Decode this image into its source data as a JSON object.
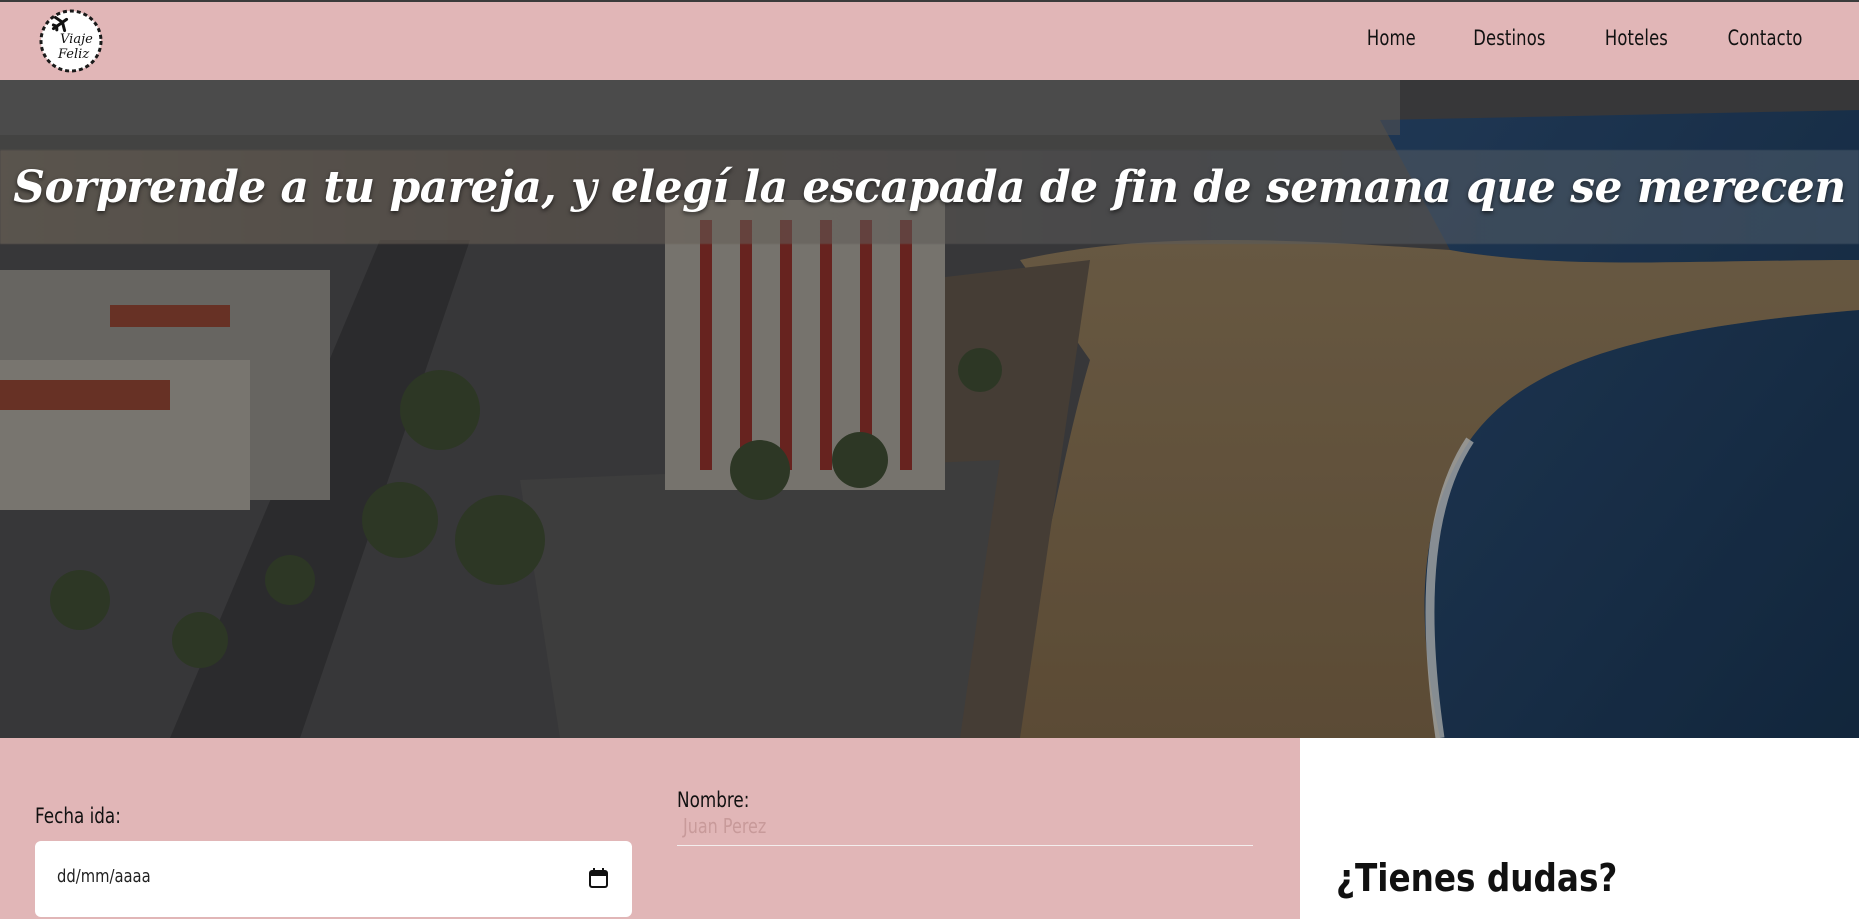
{
  "brand": {
    "logo_text_line1": "Viaje",
    "logo_text_line2": "Feliz"
  },
  "nav": {
    "items": [
      {
        "label": "Home"
      },
      {
        "label": "Destinos"
      },
      {
        "label": "Hoteles"
      },
      {
        "label": "Contacto"
      }
    ]
  },
  "hero": {
    "title": "Sorprende a tu pareja, y elegí la escapada de fin de semana que se merecen"
  },
  "form": {
    "date_label": "Fecha ida:",
    "date_value": "dd/mm/aaaa",
    "name_label": "Nombre:",
    "name_placeholder": "Juan Perez"
  },
  "side": {
    "title": "¿Tienes dudas?"
  },
  "colors": {
    "accent_pink": "#e1b6b7",
    "text_dark": "#111111",
    "white": "#ffffff"
  },
  "icons": {
    "logo": "airplane-stamp-icon",
    "date_picker": "calendar-icon"
  }
}
